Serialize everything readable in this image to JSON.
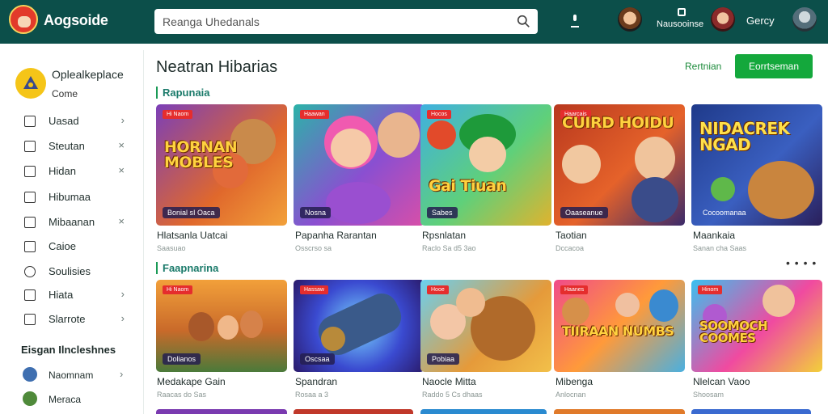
{
  "header": {
    "brand": "Aogsoide",
    "search_placeholder": "Reanga Uhedanals",
    "user_label_1": "Nausooinse",
    "user_label_2": "Gercy"
  },
  "sidebar": {
    "profile_name": "Oplealkeplace",
    "profile_sub": "Come",
    "items": [
      {
        "label": "Uasad",
        "chevron": "›"
      },
      {
        "label": "Steutan",
        "chevron": "×"
      },
      {
        "label": "Hidan",
        "chevron": "×"
      },
      {
        "label": "Hibumaa",
        "chevron": ""
      },
      {
        "label": "Mibaanan",
        "chevron": "×"
      },
      {
        "label": "Caioe",
        "chevron": ""
      },
      {
        "label": "Soulisies",
        "chevron": ""
      },
      {
        "label": "Hiata",
        "chevron": "›"
      },
      {
        "label": "Slarrote",
        "chevron": "›"
      }
    ],
    "section_title": "Eisgan Ilncleshnes",
    "section_items": [
      {
        "label": "Naomnam",
        "chevron": "›"
      },
      {
        "label": "Meraca",
        "chevron": ""
      }
    ]
  },
  "main": {
    "title": "Neatran Hibarias",
    "link_button": "Rertnian",
    "primary_button": "Eorrtseman",
    "rows": [
      {
        "title": "Rapunaia",
        "cards": [
          {
            "pill": "Hi Naom",
            "art": "HORNAN MOBLES",
            "caption": "Bonial sI Oaca",
            "title": "Hlatsanla Uatcai",
            "sub": "Saasuao"
          },
          {
            "pill": "Haawan",
            "art": "",
            "caption": "Nosna",
            "title": "Papanha Rarantan",
            "sub": "Osscrso sa"
          },
          {
            "pill": "Hocos",
            "art": "Gai Tiuan",
            "caption": "Sabes",
            "title": "Rpsnlatan",
            "sub": "Raclo Sa d5 3ao"
          },
          {
            "pill": "Haarcais",
            "art": "CUIRD HOIDU",
            "caption": "Oaaseanue",
            "title": "Taotian",
            "sub": "Dccacoa"
          },
          {
            "pill": "",
            "art": "NIDACREK NGAD",
            "caption": "Cocoomanaa",
            "title": "Maankaia",
            "sub": "Sanan cha Saas"
          }
        ]
      },
      {
        "title": "Faapnarina",
        "cards": [
          {
            "pill": "Hi Naom",
            "art": "",
            "caption": "Dolianos",
            "title": "Medakape Gain",
            "sub": "Raacas do Sas"
          },
          {
            "pill": "Hassaw",
            "art": "",
            "caption": "Oscsaa",
            "title": "Spandran",
            "sub": "Rosaa a 3"
          },
          {
            "pill": "Hooe",
            "art": "",
            "caption": "Pobiaa",
            "title": "Naocle Mitta",
            "sub": "Raddo 5 Cs dhaas"
          },
          {
            "pill": "Haanes",
            "art": "TIIRAAN NUMBS",
            "caption": "",
            "title": "Mibenga",
            "sub": "Anlocnan"
          },
          {
            "pill": "Hinom",
            "art": "SOOMOCH COOMES",
            "caption": "",
            "title": "Nlelcan Vaoo",
            "sub": "Shoosam"
          }
        ]
      }
    ],
    "more": "• • • •"
  },
  "colors": {
    "header_bg": "#0c4f4a",
    "accent_green": "#14a83c",
    "row_title": "#1a7a6a"
  }
}
